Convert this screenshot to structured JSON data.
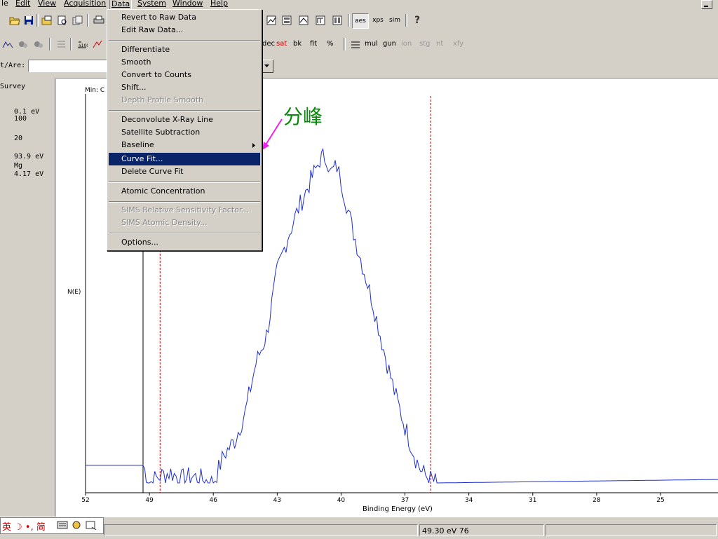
{
  "menubar": {
    "items": [
      "le",
      "Edit",
      "View",
      "Acquisition",
      "Data",
      "System",
      "Window",
      "Help"
    ],
    "underline": [
      "",
      "E",
      "V",
      "A",
      "D",
      "S",
      "W",
      "H"
    ]
  },
  "toolbar2": {
    "labels": [
      "aes",
      "xps",
      "sim",
      "?"
    ]
  },
  "toolbar3": {
    "labels": [
      "sat",
      "bk",
      "fit",
      "%",
      "mul",
      "gun",
      "ion",
      "stg",
      "nt",
      "xfy"
    ],
    "dec_label": "dec"
  },
  "toolbar4": {
    "field_label": "t/Are:",
    "field_value": ""
  },
  "left_panel": {
    "lines": [
      "Survey",
      "0.1 eV",
      "100",
      "20",
      "93.9 eV",
      "Mg",
      "4.17 eV"
    ]
  },
  "data_menu": {
    "items": [
      {
        "label": "Revert to Raw Data",
        "ul": "R",
        "enabled": true
      },
      {
        "label": "Edit Raw Data...",
        "ul": "E",
        "enabled": true
      },
      {
        "label": "Differentiate",
        "ul": "D",
        "enabled": true
      },
      {
        "label": "Smooth",
        "ul": "S",
        "enabled": true
      },
      {
        "label": "Convert to Counts",
        "ul": "C",
        "enabled": true
      },
      {
        "label": "Shift...",
        "ul": "h",
        "enabled": true
      },
      {
        "label": "Depth Profile Smooth",
        "ul": "P",
        "enabled": false
      },
      {
        "label": "Deconvolute X-Ray Line",
        "ul": "X",
        "enabled": true
      },
      {
        "label": "Satellite Subtraction",
        "ul": "t",
        "enabled": true
      },
      {
        "label": "Baseline",
        "ul": "B",
        "enabled": true,
        "submenu": true
      },
      {
        "label": "Curve Fit...",
        "ul": "F",
        "enabled": true,
        "selected": true
      },
      {
        "label": "Delete Curve Fit",
        "ul": "l",
        "enabled": true
      },
      {
        "label": "Atomic Concentration",
        "ul": "A",
        "enabled": true
      },
      {
        "label": "SIMS Relative Sensitivity Factor...",
        "ul": "F",
        "enabled": false
      },
      {
        "label": "SIMS Atomic Density...",
        "ul": "I",
        "enabled": false
      },
      {
        "label": "Options...",
        "ul": "O",
        "enabled": true
      }
    ]
  },
  "plot": {
    "min_label": "Min: C",
    "ylabel": "N(E)",
    "xlabel": "Binding Energy (eV)",
    "annotation": "分峰"
  },
  "chart_data": {
    "type": "line",
    "xlabel": "Binding Energy (eV)",
    "ylabel": "N(E)",
    "xlim": [
      52,
      22
    ],
    "x_ticks": [
      52,
      49,
      46,
      43,
      40,
      37,
      34,
      31,
      28,
      25
    ],
    "markers": [
      48.5,
      35.8
    ],
    "series": [
      {
        "x": [
          52,
          49.3,
          49.0,
          48.5,
          48.0,
          47.5,
          47.0,
          46.5,
          46.0,
          45.5,
          45.0,
          44.5,
          44.0,
          43.5,
          43.0,
          42.5,
          42.0,
          41.5,
          41.2,
          41.0,
          40.7,
          40.5,
          40.2,
          40.0,
          39.5,
          39.0,
          38.5,
          38.0,
          37.5,
          37.0,
          36.5,
          36.2,
          35.8,
          35.5,
          22
        ],
        "y": [
          5,
          5,
          0,
          2,
          3,
          1,
          2,
          1,
          0,
          8,
          12,
          20,
          34,
          42,
          60,
          70,
          78,
          85,
          89,
          92,
          93,
          88,
          90,
          86,
          73,
          62,
          51,
          38,
          26,
          16,
          7,
          3,
          1,
          0,
          1
        ]
      }
    ]
  },
  "status": {
    "coords": "49.30 eV  76"
  },
  "ime": {
    "text": "英 ☽ •, 简"
  },
  "colors": {
    "trace": "#1f2fcc",
    "marker": "#cc0000",
    "annotation": "#0a8a0a",
    "arrow": "#ee22ee",
    "menu_highlight": "#0a246a"
  }
}
